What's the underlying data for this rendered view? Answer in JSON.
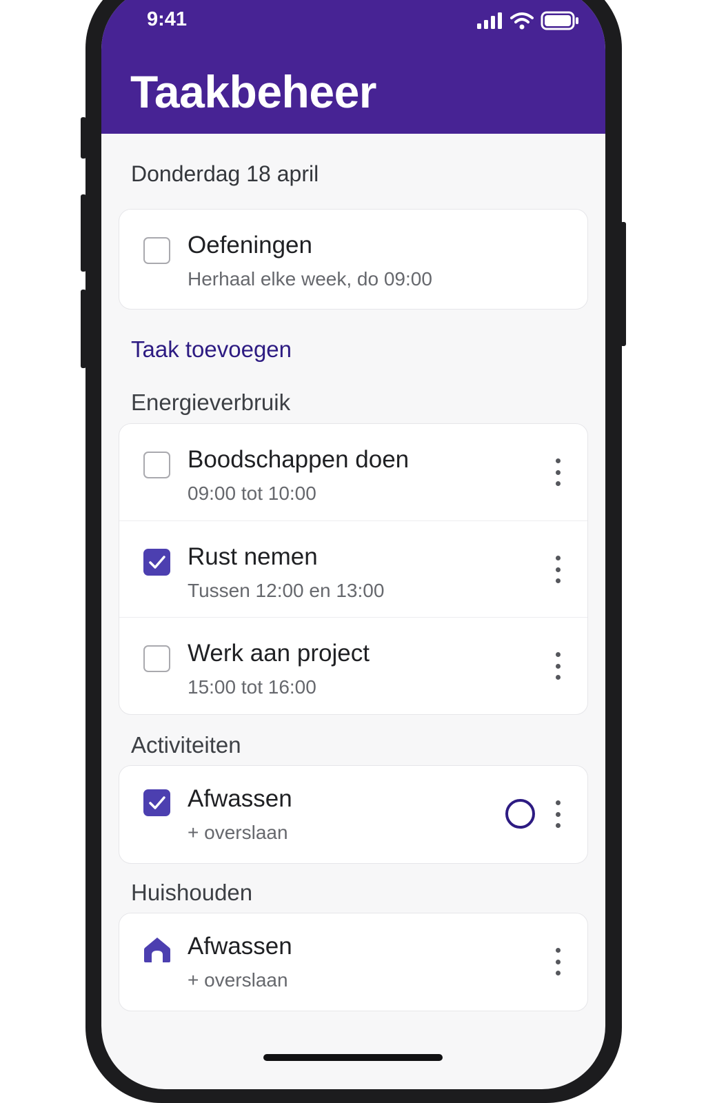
{
  "status_bar": {
    "time": "9:41"
  },
  "header": {
    "title": "Taakbeheer"
  },
  "date_heading": "Donderdag 18 april",
  "featured_task": {
    "title": "Oefeningen",
    "subtitle": "Herhaal elke week, do 09:00",
    "checked": false
  },
  "add_task_label": "Taak toevoegen",
  "sections": [
    {
      "heading": "Energieverbruik",
      "tasks": [
        {
          "title": "Boodschappen doen",
          "subtitle": "09:00 tot 10:00",
          "checked": false
        },
        {
          "title": "Rust nemen",
          "subtitle": "Tussen 12:00 en 13:00",
          "checked": true
        },
        {
          "title": "Werk aan project",
          "subtitle": "15:00 tot 16:00",
          "checked": false
        }
      ]
    },
    {
      "heading": "Activiteiten",
      "tasks": [
        {
          "title": "Afwassen",
          "subtitle": "+ overslaan",
          "checked": true
        }
      ]
    },
    {
      "heading": "Huishouden",
      "tasks": [
        {
          "title": "Afwassen",
          "subtitle": "+ overslaan",
          "icon": "home-icon"
        }
      ]
    }
  ],
  "colors": {
    "header": "#472394",
    "accent": "#4c3fb0",
    "link": "#2d1b82",
    "background": "#f7f7f8"
  }
}
